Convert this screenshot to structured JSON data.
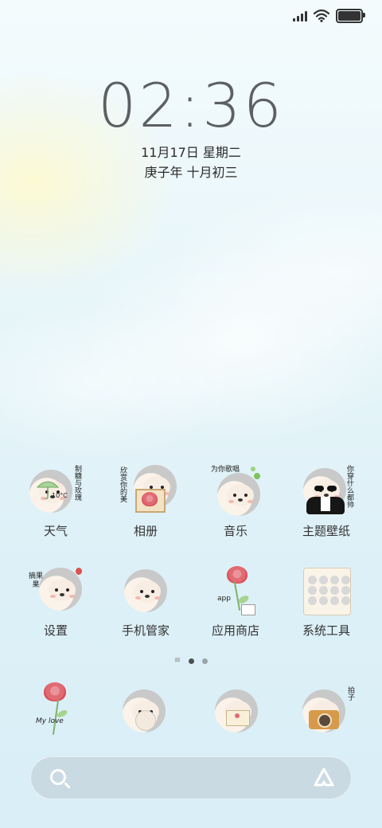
{
  "status_bar": {
    "signal_icon": "signal-icon",
    "wifi_icon": "wifi-icon",
    "battery_icon": "battery-icon",
    "battery_level": 1.0
  },
  "lockscreen": {
    "time": "02:36",
    "date": "11月17日 星期二",
    "lunar_date": "庚子年 十月初三"
  },
  "apps": [
    {
      "label": "天气",
      "icon": "weather-hedgehog-icon",
      "caption": "制糖与玫瑰",
      "badge": "10°C"
    },
    {
      "label": "相册",
      "icon": "gallery-hedgehog-icon",
      "caption": "欣赏你的美"
    },
    {
      "label": "音乐",
      "icon": "music-hedgehog-icon",
      "caption": "为你歌唱"
    },
    {
      "label": "主题壁纸",
      "icon": "theme-hedgehog-icon",
      "caption": "你穿什么都帅"
    },
    {
      "label": "设置",
      "icon": "settings-hedgehog-icon",
      "caption": "摘果果"
    },
    {
      "label": "手机管家",
      "icon": "security-hedgehog-icon"
    },
    {
      "label": "应用商店",
      "icon": "appstore-rose-icon",
      "caption": "app"
    },
    {
      "label": "系统工具",
      "icon": "tools-hedgehog-icon"
    }
  ],
  "page_indicator": {
    "pages": 2,
    "current": 1
  },
  "dock": [
    {
      "icon": "rose-mylove-icon",
      "caption": "My love"
    },
    {
      "icon": "phone-hedgehog-icon"
    },
    {
      "icon": "message-hedgehog-icon"
    },
    {
      "icon": "camera-hedgehog-icon",
      "caption": "拍子"
    }
  ],
  "search": {
    "search_icon": "search-icon",
    "assistant_icon": "assistant-icon"
  }
}
